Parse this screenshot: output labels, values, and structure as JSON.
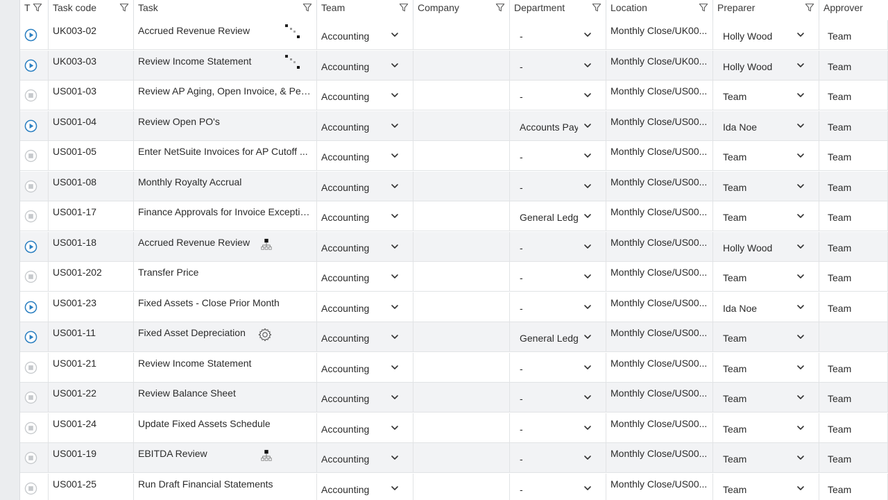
{
  "columns": {
    "status": "T",
    "task_code": "Task code",
    "task": "Task",
    "team": "Team",
    "company": "Company",
    "department": "Department",
    "location": "Location",
    "preparer": "Preparer",
    "approver": "Approver"
  },
  "colors": {
    "accent_blue": "#2a7fc1",
    "inactive_gray": "#c6c9cc",
    "row_alt": "#f2f3f5"
  },
  "rows": [
    {
      "status": "active",
      "code": "UK003-02",
      "task": "Accrued Revenue Review",
      "task_icon": "dependency-icon",
      "team": "Accounting",
      "department": "-",
      "location": "Monthly Close/UK00...",
      "preparer": "Holly Wood",
      "approver": "Team"
    },
    {
      "status": "active",
      "code": "UK003-03",
      "task": "Review Income Statement",
      "task_icon": "dependency-icon",
      "team": "Accounting",
      "department": "-",
      "location": "Monthly Close/UK00...",
      "preparer": "Holly Wood",
      "approver": "Team"
    },
    {
      "status": "inactive",
      "code": "US001-03",
      "task": "Review AP Aging, Open Invoice, & Pen...",
      "task_icon": "",
      "team": "Accounting",
      "department": "-",
      "location": "Monthly Close/US00...",
      "preparer": "Team",
      "approver": "Team"
    },
    {
      "status": "active",
      "code": "US001-04",
      "task": "Review Open PO's",
      "task_icon": "",
      "team": "Accounting",
      "department": "Accounts Pay",
      "location": "Monthly Close/US00...",
      "preparer": "Ida Noe",
      "approver": "Team"
    },
    {
      "status": "inactive",
      "code": "US001-05",
      "task": "Enter NetSuite Invoices for AP Cutoff ...",
      "task_icon": "",
      "team": "Accounting",
      "department": "-",
      "location": "Monthly Close/US00...",
      "preparer": "Team",
      "approver": "Team"
    },
    {
      "status": "inactive",
      "code": "US001-08",
      "task": "Monthly Royalty Accrual",
      "task_icon": "",
      "team": "Accounting",
      "department": "-",
      "location": "Monthly Close/US00...",
      "preparer": "Team",
      "approver": "Team"
    },
    {
      "status": "inactive",
      "code": "US001-17",
      "task": "Finance Approvals for Invoice Exceptio...",
      "task_icon": "",
      "team": "Accounting",
      "department": "General Ledg",
      "location": "Monthly Close/US00...",
      "preparer": "Team",
      "approver": "Team"
    },
    {
      "status": "active",
      "code": "US001-18",
      "task": "Accrued Revenue Review",
      "task_icon": "hierarchy-icon",
      "team": "Accounting",
      "department": "-",
      "location": "Monthly Close/US00...",
      "preparer": "Holly Wood",
      "approver": "Team"
    },
    {
      "status": "inactive",
      "code": "US001-202",
      "task": "Transfer Price",
      "task_icon": "",
      "team": "Accounting",
      "department": "-",
      "location": "Monthly Close/US00...",
      "preparer": "Team",
      "approver": "Team"
    },
    {
      "status": "active",
      "code": "US001-23",
      "task": "Fixed Assets - Close Prior Month",
      "task_icon": "",
      "team": "Accounting",
      "department": "-",
      "location": "Monthly Close/US00...",
      "preparer": "Ida Noe",
      "approver": "Team"
    },
    {
      "status": "active",
      "code": "US001-11",
      "task": "Fixed Asset Depreciation",
      "task_icon": "gear-icon",
      "team": "Accounting",
      "department": "General Ledg",
      "location": "Monthly Close/US00...",
      "preparer": "Team",
      "approver": ""
    },
    {
      "status": "inactive",
      "code": "US001-21",
      "task": "Review Income Statement",
      "task_icon": "",
      "team": "Accounting",
      "department": "-",
      "location": "Monthly Close/US00...",
      "preparer": "Team",
      "approver": "Team"
    },
    {
      "status": "inactive",
      "code": "US001-22",
      "task": "Review Balance Sheet",
      "task_icon": "",
      "team": "Accounting",
      "department": "-",
      "location": "Monthly Close/US00...",
      "preparer": "Team",
      "approver": "Team"
    },
    {
      "status": "inactive",
      "code": "US001-24",
      "task": "Update Fixed Assets Schedule",
      "task_icon": "",
      "team": "Accounting",
      "department": "-",
      "location": "Monthly Close/US00...",
      "preparer": "Team",
      "approver": "Team"
    },
    {
      "status": "inactive",
      "code": "US001-19",
      "task": "EBITDA Review",
      "task_icon": "hierarchy-icon",
      "team": "Accounting",
      "department": "-",
      "location": "Monthly Close/US00...",
      "preparer": "Team",
      "approver": "Team"
    },
    {
      "status": "inactive",
      "code": "US001-25",
      "task": "Run Draft Financial Statements",
      "task_icon": "",
      "team": "Accounting",
      "department": "-",
      "location": "Monthly Close/US00...",
      "preparer": "Team",
      "approver": "Team"
    }
  ]
}
